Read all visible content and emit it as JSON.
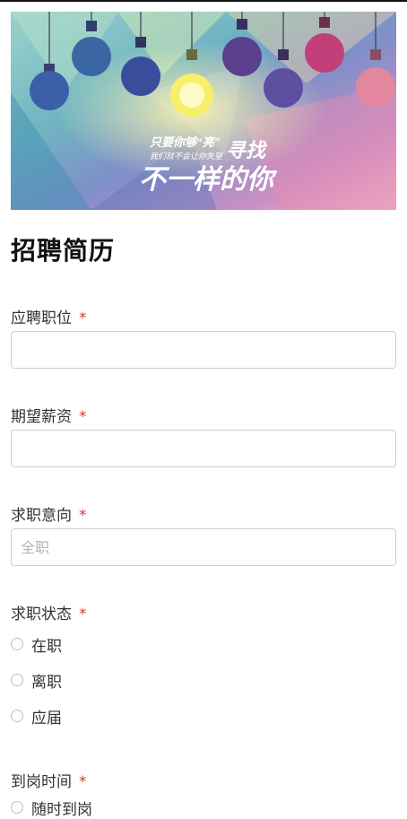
{
  "banner": {
    "tagline_1": "只要你够“亮”",
    "tagline_2": "寻找",
    "tagline_3": "我们就不会让你失望",
    "headline": "不一样的你"
  },
  "page": {
    "title": "招聘简历",
    "required_mark": "*"
  },
  "form": {
    "position": {
      "label": "应聘职位",
      "value": "",
      "placeholder": ""
    },
    "salary": {
      "label": "期望薪资",
      "value": "",
      "placeholder": ""
    },
    "intention": {
      "label": "求职意向",
      "value": "",
      "placeholder": "全职"
    },
    "status": {
      "label": "求职状态",
      "options": [
        "在职",
        "离职",
        "应届"
      ]
    },
    "arrival": {
      "label": "到岗时间",
      "options": [
        "随时到岗"
      ]
    }
  }
}
